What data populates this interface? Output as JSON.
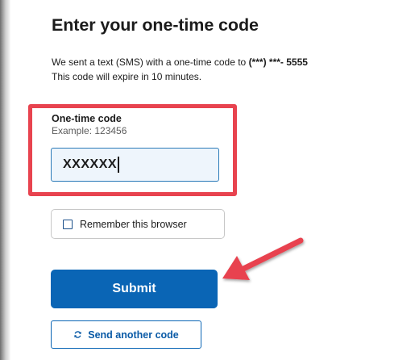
{
  "page": {
    "title": "Enter your one-time code"
  },
  "intro": {
    "line1_prefix": "We sent a text (SMS) with a one-time code to",
    "masked_phone": "(***) ***-",
    "phone_last4": "5555",
    "line2": "This code will expire in 10 minutes."
  },
  "code_field": {
    "label": "One-time code",
    "hint": "Example: 123456",
    "value": "XXXXXX"
  },
  "remember": {
    "label": "Remember this browser",
    "checked": false
  },
  "buttons": {
    "submit_label": "Submit",
    "send_another_label": "Send another code"
  },
  "annotations": {
    "highlight_color": "#e8434f",
    "arrow_color": "#e8434f"
  },
  "icons": {
    "send_another": "refresh-icon",
    "remember": "checkbox"
  },
  "colors": {
    "primary": "#0a65b5",
    "text": "#1b1b1b",
    "input_focus": "#2a7ab8"
  }
}
